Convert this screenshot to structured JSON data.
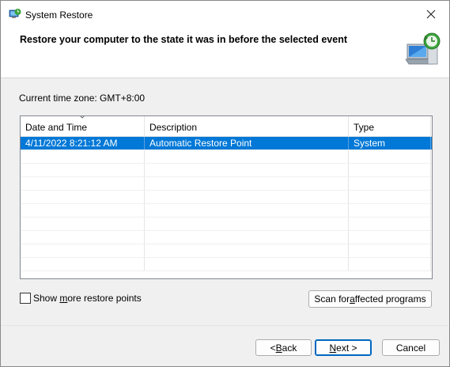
{
  "window": {
    "title": "System Restore",
    "close_glyph": "✕"
  },
  "header": {
    "heading": "Restore your computer to the state it was in before the selected event"
  },
  "timezone": {
    "label": "Current time zone: GMT+8:00"
  },
  "table": {
    "columns": [
      "Date and Time",
      "Description",
      "Type"
    ],
    "rows": [
      {
        "date": "4/11/2022 8:21:12 AM",
        "description": "Automatic Restore Point",
        "type": "System",
        "selected": true
      }
    ],
    "empty_row_count": 9
  },
  "checkbox": {
    "label_pre": "Show ",
    "label_mnemonic": "m",
    "label_post": "ore restore points",
    "checked": false
  },
  "buttons": {
    "scan_pre": "Scan for ",
    "scan_mnemonic": "a",
    "scan_post": "ffected programs",
    "back_pre": "< ",
    "back_mnemonic": "B",
    "back_post": "ack",
    "next_mnemonic": "N",
    "next_post": "ext >",
    "cancel": "Cancel"
  },
  "colors": {
    "selection": "#0078d7",
    "accent": "#0067c0"
  }
}
